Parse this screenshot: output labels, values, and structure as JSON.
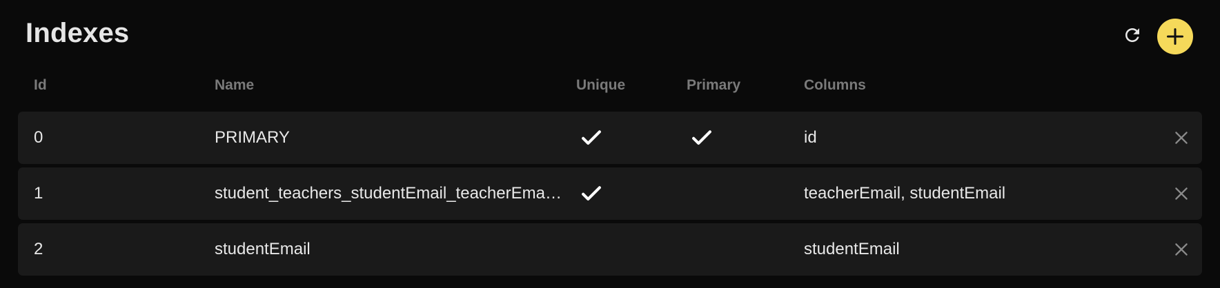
{
  "panel": {
    "title": "Indexes"
  },
  "actions": {
    "refresh_icon": "refresh-icon",
    "add_icon": "plus-icon",
    "accent_color": "#f5d95a"
  },
  "table": {
    "headers": {
      "id": "Id",
      "name": "Name",
      "unique": "Unique",
      "primary": "Primary",
      "columns": "Columns"
    },
    "rows": [
      {
        "id": "0",
        "name": "PRIMARY",
        "unique": true,
        "primary": true,
        "columns": "id"
      },
      {
        "id": "1",
        "name": "student_teachers_studentEmail_teacherEmail_unique",
        "unique": true,
        "primary": false,
        "columns": "teacherEmail, studentEmail"
      },
      {
        "id": "2",
        "name": "studentEmail",
        "unique": false,
        "primary": false,
        "columns": "studentEmail"
      }
    ]
  }
}
